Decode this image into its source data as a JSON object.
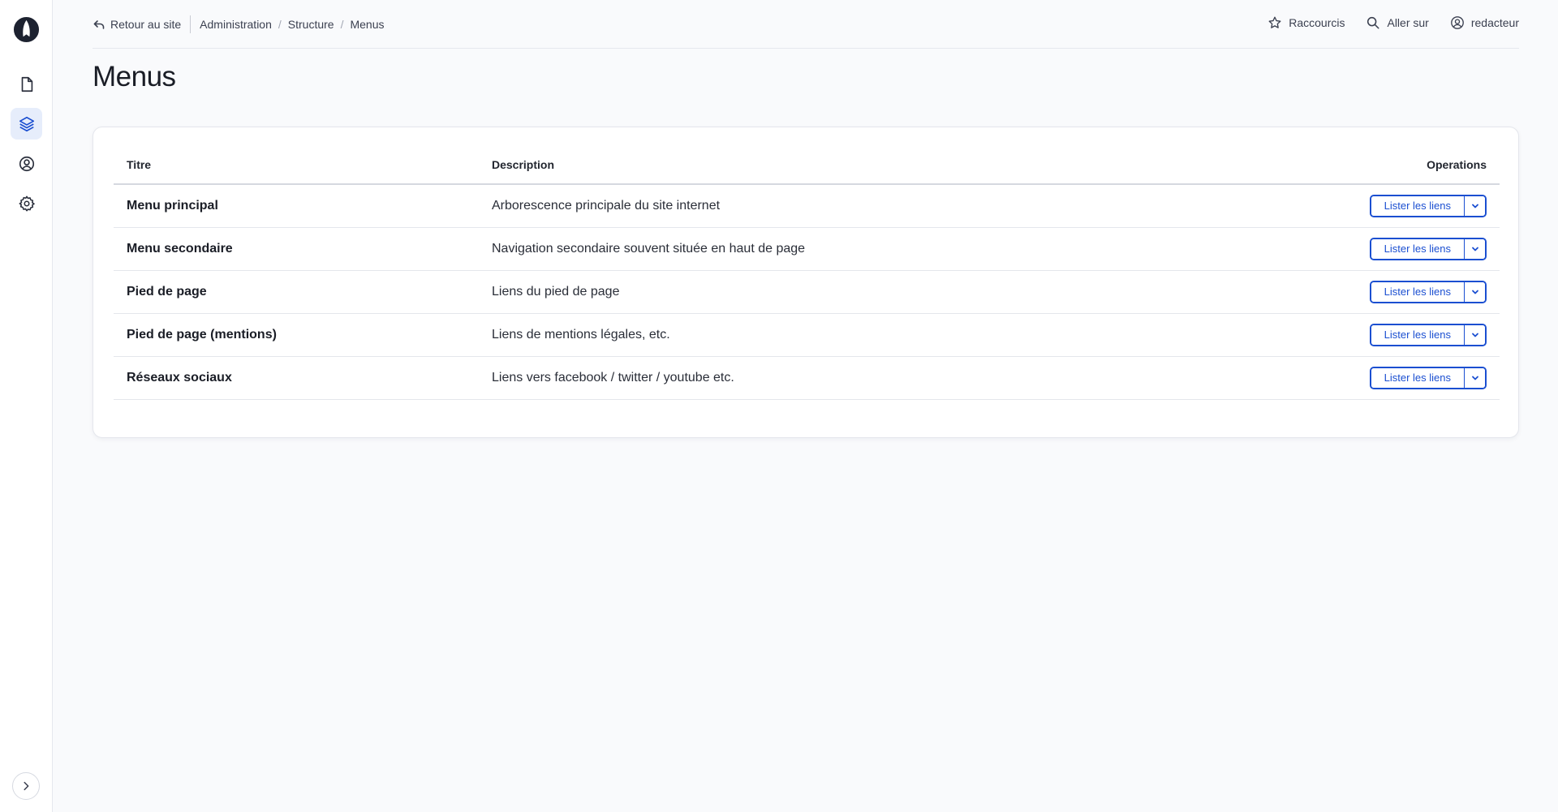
{
  "breadcrumb": {
    "back": "Retour au site",
    "items": [
      "Administration",
      "Structure",
      "Menus"
    ]
  },
  "top_actions": {
    "shortcuts": "Raccourcis",
    "goto": "Aller sur",
    "user": "redacteur"
  },
  "page": {
    "title": "Menus"
  },
  "table": {
    "headers": {
      "title": "Titre",
      "description": "Description",
      "operations": "Operations"
    },
    "rows": [
      {
        "title": "Menu principal",
        "description": "Arborescence principale du site internet",
        "action": "Lister les liens"
      },
      {
        "title": "Menu secondaire",
        "description": "Navigation secondaire souvent située en haut de page",
        "action": "Lister les liens"
      },
      {
        "title": "Pied de page",
        "description": "Liens du pied de page",
        "action": "Lister les liens"
      },
      {
        "title": "Pied de page (mentions)",
        "description": "Liens de mentions légales, etc.",
        "action": "Lister les liens"
      },
      {
        "title": "Réseaux sociaux",
        "description": "Liens vers facebook / twitter / youtube etc.",
        "action": "Lister les liens"
      }
    ]
  },
  "sidebar": {
    "icons": [
      "rocket-logo-icon",
      "file-icon",
      "layers-icon",
      "user-circle-icon",
      "gear-icon",
      "chevron-right-icon"
    ],
    "active": "layers-icon"
  },
  "colors": {
    "accent": "#1b4fd1",
    "active_bg": "#e6edfb",
    "background": "#f9fafc"
  }
}
